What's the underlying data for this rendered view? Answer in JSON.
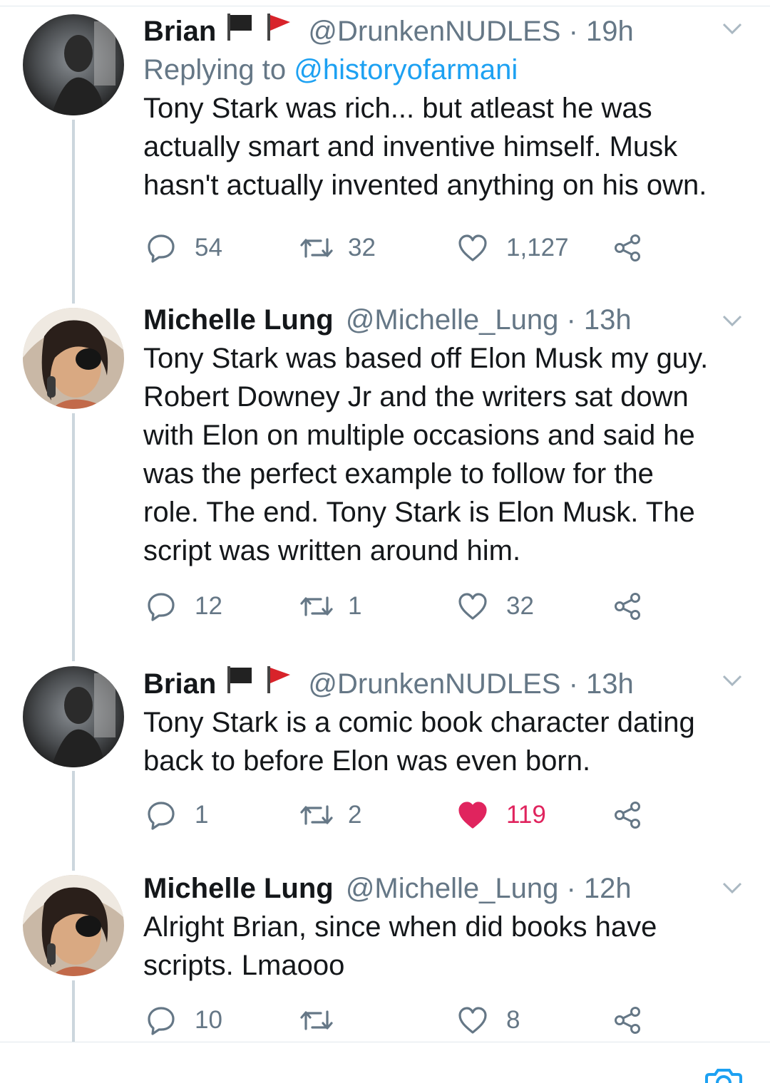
{
  "tweets": [
    {
      "name": "Brian",
      "flags": [
        "black-flag",
        "red-flag"
      ],
      "handle": "@DrunkenNUDLES",
      "time": "· 19h",
      "replying_prefix": "Replying to ",
      "replying_handle": "@historyofarmani",
      "lines": [
        "Tony Stark was rich... but atleast he was",
        "actually smart and inventive himself. Musk",
        "hasn't actually invented anything on his own."
      ],
      "replies": "54",
      "retweets": "32",
      "likes": "1,127",
      "liked": false
    },
    {
      "name": "Michelle Lung",
      "handle": "@Michelle_Lung",
      "time": "· 13h",
      "lines": [
        "Tony Stark was based off Elon Musk my guy.",
        "Robert Downey Jr and the writers sat down",
        "with Elon on multiple occasions and said he",
        "was the perfect example to follow for the",
        "role. The end. Tony Stark is Elon Musk. The",
        "script was written around him."
      ],
      "replies": "12",
      "retweets": "1",
      "likes": "32",
      "liked": false
    },
    {
      "name": "Brian",
      "flags": [
        "black-flag",
        "red-flag"
      ],
      "handle": "@DrunkenNUDLES",
      "time": "· 13h",
      "lines": [
        "Tony Stark is a comic book character dating",
        "back to before Elon was even born."
      ],
      "replies": "1",
      "retweets": "2",
      "likes": "119",
      "liked": true
    },
    {
      "name": "Michelle Lung",
      "handle": "@Michelle_Lung",
      "time": "· 12h",
      "lines": [
        "Alright Brian, since when did books have",
        "scripts. Lmaooo"
      ],
      "replies": "10",
      "retweets": "",
      "likes": "8",
      "liked": false
    }
  ],
  "colors": {
    "text": "#14171a",
    "secondary": "#657786",
    "link": "#1da1f2",
    "like_active": "#e0245e",
    "thread_line": "#ccd6dd"
  },
  "icons": [
    "reply-icon",
    "retweet-icon",
    "like-icon",
    "share-icon",
    "chevron-down-icon",
    "camera-icon"
  ]
}
